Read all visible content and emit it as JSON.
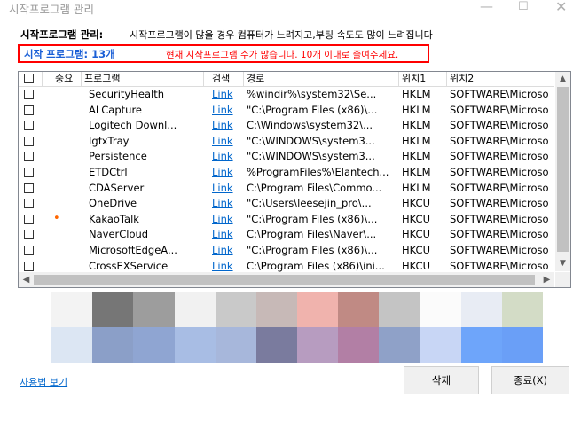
{
  "window": {
    "title": "시작프로그램 관리",
    "min_glyph": "—",
    "max_glyph": "☐",
    "close_glyph": "✕"
  },
  "header": {
    "label": "시작프로그램 관리:",
    "description": "시작프로그램이 많을 경우 컴퓨터가 느려지고,부팅 속도도 많이 느려집니다"
  },
  "alert": {
    "count_label": "시작 프로그램: 13개",
    "warning": "현재 시작프로그램 수가 많습니다. 10개 이내로 줄여주세요."
  },
  "table": {
    "columns": [
      "",
      "중요",
      "프로그램",
      "검색",
      "경로",
      "위치1",
      "위치2"
    ],
    "rows": [
      {
        "important": "",
        "program": "SecurityHealth",
        "search": "Link",
        "path": "%windir%\\system32\\Se...",
        "loc1": "HKLM",
        "loc2": "SOFTWARE\\Microso"
      },
      {
        "important": "",
        "program": "ALCapture",
        "search": "Link",
        "path": "\"C:\\Program Files (x86)\\...",
        "loc1": "HKLM",
        "loc2": "SOFTWARE\\Microso"
      },
      {
        "important": "",
        "program": "Logitech Downl...",
        "search": "Link",
        "path": "C:\\Windows\\system32\\...",
        "loc1": "HKLM",
        "loc2": "SOFTWARE\\Microso"
      },
      {
        "important": "",
        "program": "IgfxTray",
        "search": "Link",
        "path": "\"C:\\WINDOWS\\system3...",
        "loc1": "HKLM",
        "loc2": "SOFTWARE\\Microso"
      },
      {
        "important": "",
        "program": "Persistence",
        "search": "Link",
        "path": "\"C:\\WINDOWS\\system3...",
        "loc1": "HKLM",
        "loc2": "SOFTWARE\\Microso"
      },
      {
        "important": "",
        "program": "ETDCtrl",
        "search": "Link",
        "path": "%ProgramFiles%\\Elantech...",
        "loc1": "HKLM",
        "loc2": "SOFTWARE\\Microso"
      },
      {
        "important": "",
        "program": "CDAServer",
        "search": "Link",
        "path": "C:\\Program Files\\Commo...",
        "loc1": "HKLM",
        "loc2": "SOFTWARE\\Microso"
      },
      {
        "important": "",
        "program": "OneDrive",
        "search": "Link",
        "path": "\"C:\\Users\\leesejin_pro\\...",
        "loc1": "HKCU",
        "loc2": "SOFTWARE\\Microso"
      },
      {
        "important": "•",
        "program": "KakaoTalk",
        "search": "Link",
        "path": "\"C:\\Program Files (x86)\\...",
        "loc1": "HKCU",
        "loc2": "SOFTWARE\\Microso"
      },
      {
        "important": "",
        "program": "NaverCloud",
        "search": "Link",
        "path": "C:\\Program Files\\Naver\\...",
        "loc1": "HKCU",
        "loc2": "SOFTWARE\\Microso"
      },
      {
        "important": "",
        "program": "MicrosoftEdgeA...",
        "search": "Link",
        "path": "\"C:\\Program Files (x86)\\...",
        "loc1": "HKCU",
        "loc2": "SOFTWARE\\Microso"
      },
      {
        "important": "",
        "program": "CrossEXService",
        "search": "Link",
        "path": "C:\\Program Files (x86)\\ini...",
        "loc1": "HKCU",
        "loc2": "SOFTWARE\\Microso"
      }
    ]
  },
  "scroll": {
    "up": "▲",
    "down": "▼",
    "left": "◀",
    "right": "▶"
  },
  "palette_colors": [
    "#f3f3f3",
    "#767676",
    "#9d9d9d",
    "#f1f1f1",
    "#c9c9c9",
    "#c7b9b7",
    "#f0b3ad",
    "#c08a84",
    "#c4c4c4",
    "#fbfbfb",
    "#e8ecf4",
    "#d3dcc6",
    "#dce6f3",
    "#8b9fc8",
    "#8fa5d2",
    "#a8bde4",
    "#a7b7db",
    "#7a7b9e",
    "#b79cc0",
    "#b27fa5",
    "#8fa1c8",
    "#c8d6f5",
    "#6ea5fa",
    "#6a9ff7"
  ],
  "footer": {
    "view_by_user": "사용법 보기",
    "delete_label": "삭제",
    "close_label": "종료(X)"
  }
}
